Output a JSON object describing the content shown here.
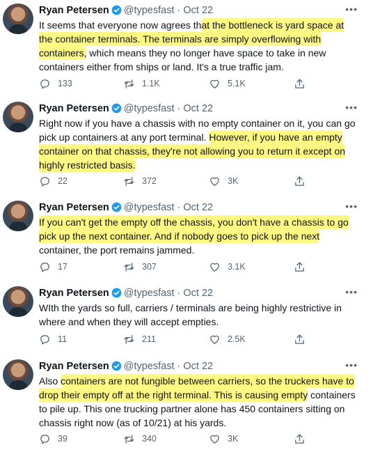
{
  "author": {
    "name": "Ryan Petersen",
    "handle": "@typesfast",
    "date": "Oct 22"
  },
  "icons": {
    "reply": "reply-icon",
    "retweet": "retweet-icon",
    "like": "like-icon",
    "share": "share-icon",
    "more": "more-icon",
    "verified": "verified-badge-icon"
  },
  "colors": {
    "highlight": "#fff55a",
    "muted": "#536471",
    "verified": "#1d9bf0"
  },
  "tweets": [
    {
      "parts": [
        [
          "It seems that everyone now agrees th",
          false
        ],
        [
          "at the bottleneck is yard space at the container terminals. The terminals are simply overflowing with containers,",
          true
        ],
        [
          " which means they no longer have space to take in new containers either from ships or land. It's a true traffic jam.",
          false
        ]
      ],
      "replies": "133",
      "retweets": "1.1K",
      "likes": "5.1K"
    },
    {
      "parts": [
        [
          "Right now if you have a chassis with no empty container on it, you can go pick up containers at any port terminal. ",
          false
        ],
        [
          "However, if you have an empty container on that chassis, they're not allowing you to return it except on highly restricted basis.",
          true
        ]
      ],
      "replies": "22",
      "retweets": "372",
      "likes": "3K"
    },
    {
      "parts": [
        [
          "If you can't get the empty off the chassis, you don't have a chassis to go pick up the next container. And if nobody goes to pick up the next",
          true
        ],
        [
          " container, the port remains jammed.",
          false
        ]
      ],
      "replies": "17",
      "retweets": "307",
      "likes": "3.1K"
    },
    {
      "parts": [
        [
          "WIth the yards so full, carriers / terminals are being highly restrictive in where and when they will accept empties.",
          false
        ]
      ],
      "replies": "11",
      "retweets": "211",
      "likes": "2.5K"
    },
    {
      "parts": [
        [
          "Also ",
          false
        ],
        [
          "containers are not fungible between carriers, so the truckers have to drop their empty off at the right terminal. This is causing empty",
          true
        ],
        [
          " containers to pile up. This one trucking partner alone has 450 containers sitting on chassis right now (as of 10/21) at his yards.",
          false
        ]
      ],
      "replies": "39",
      "retweets": "340",
      "likes": "3K"
    }
  ]
}
